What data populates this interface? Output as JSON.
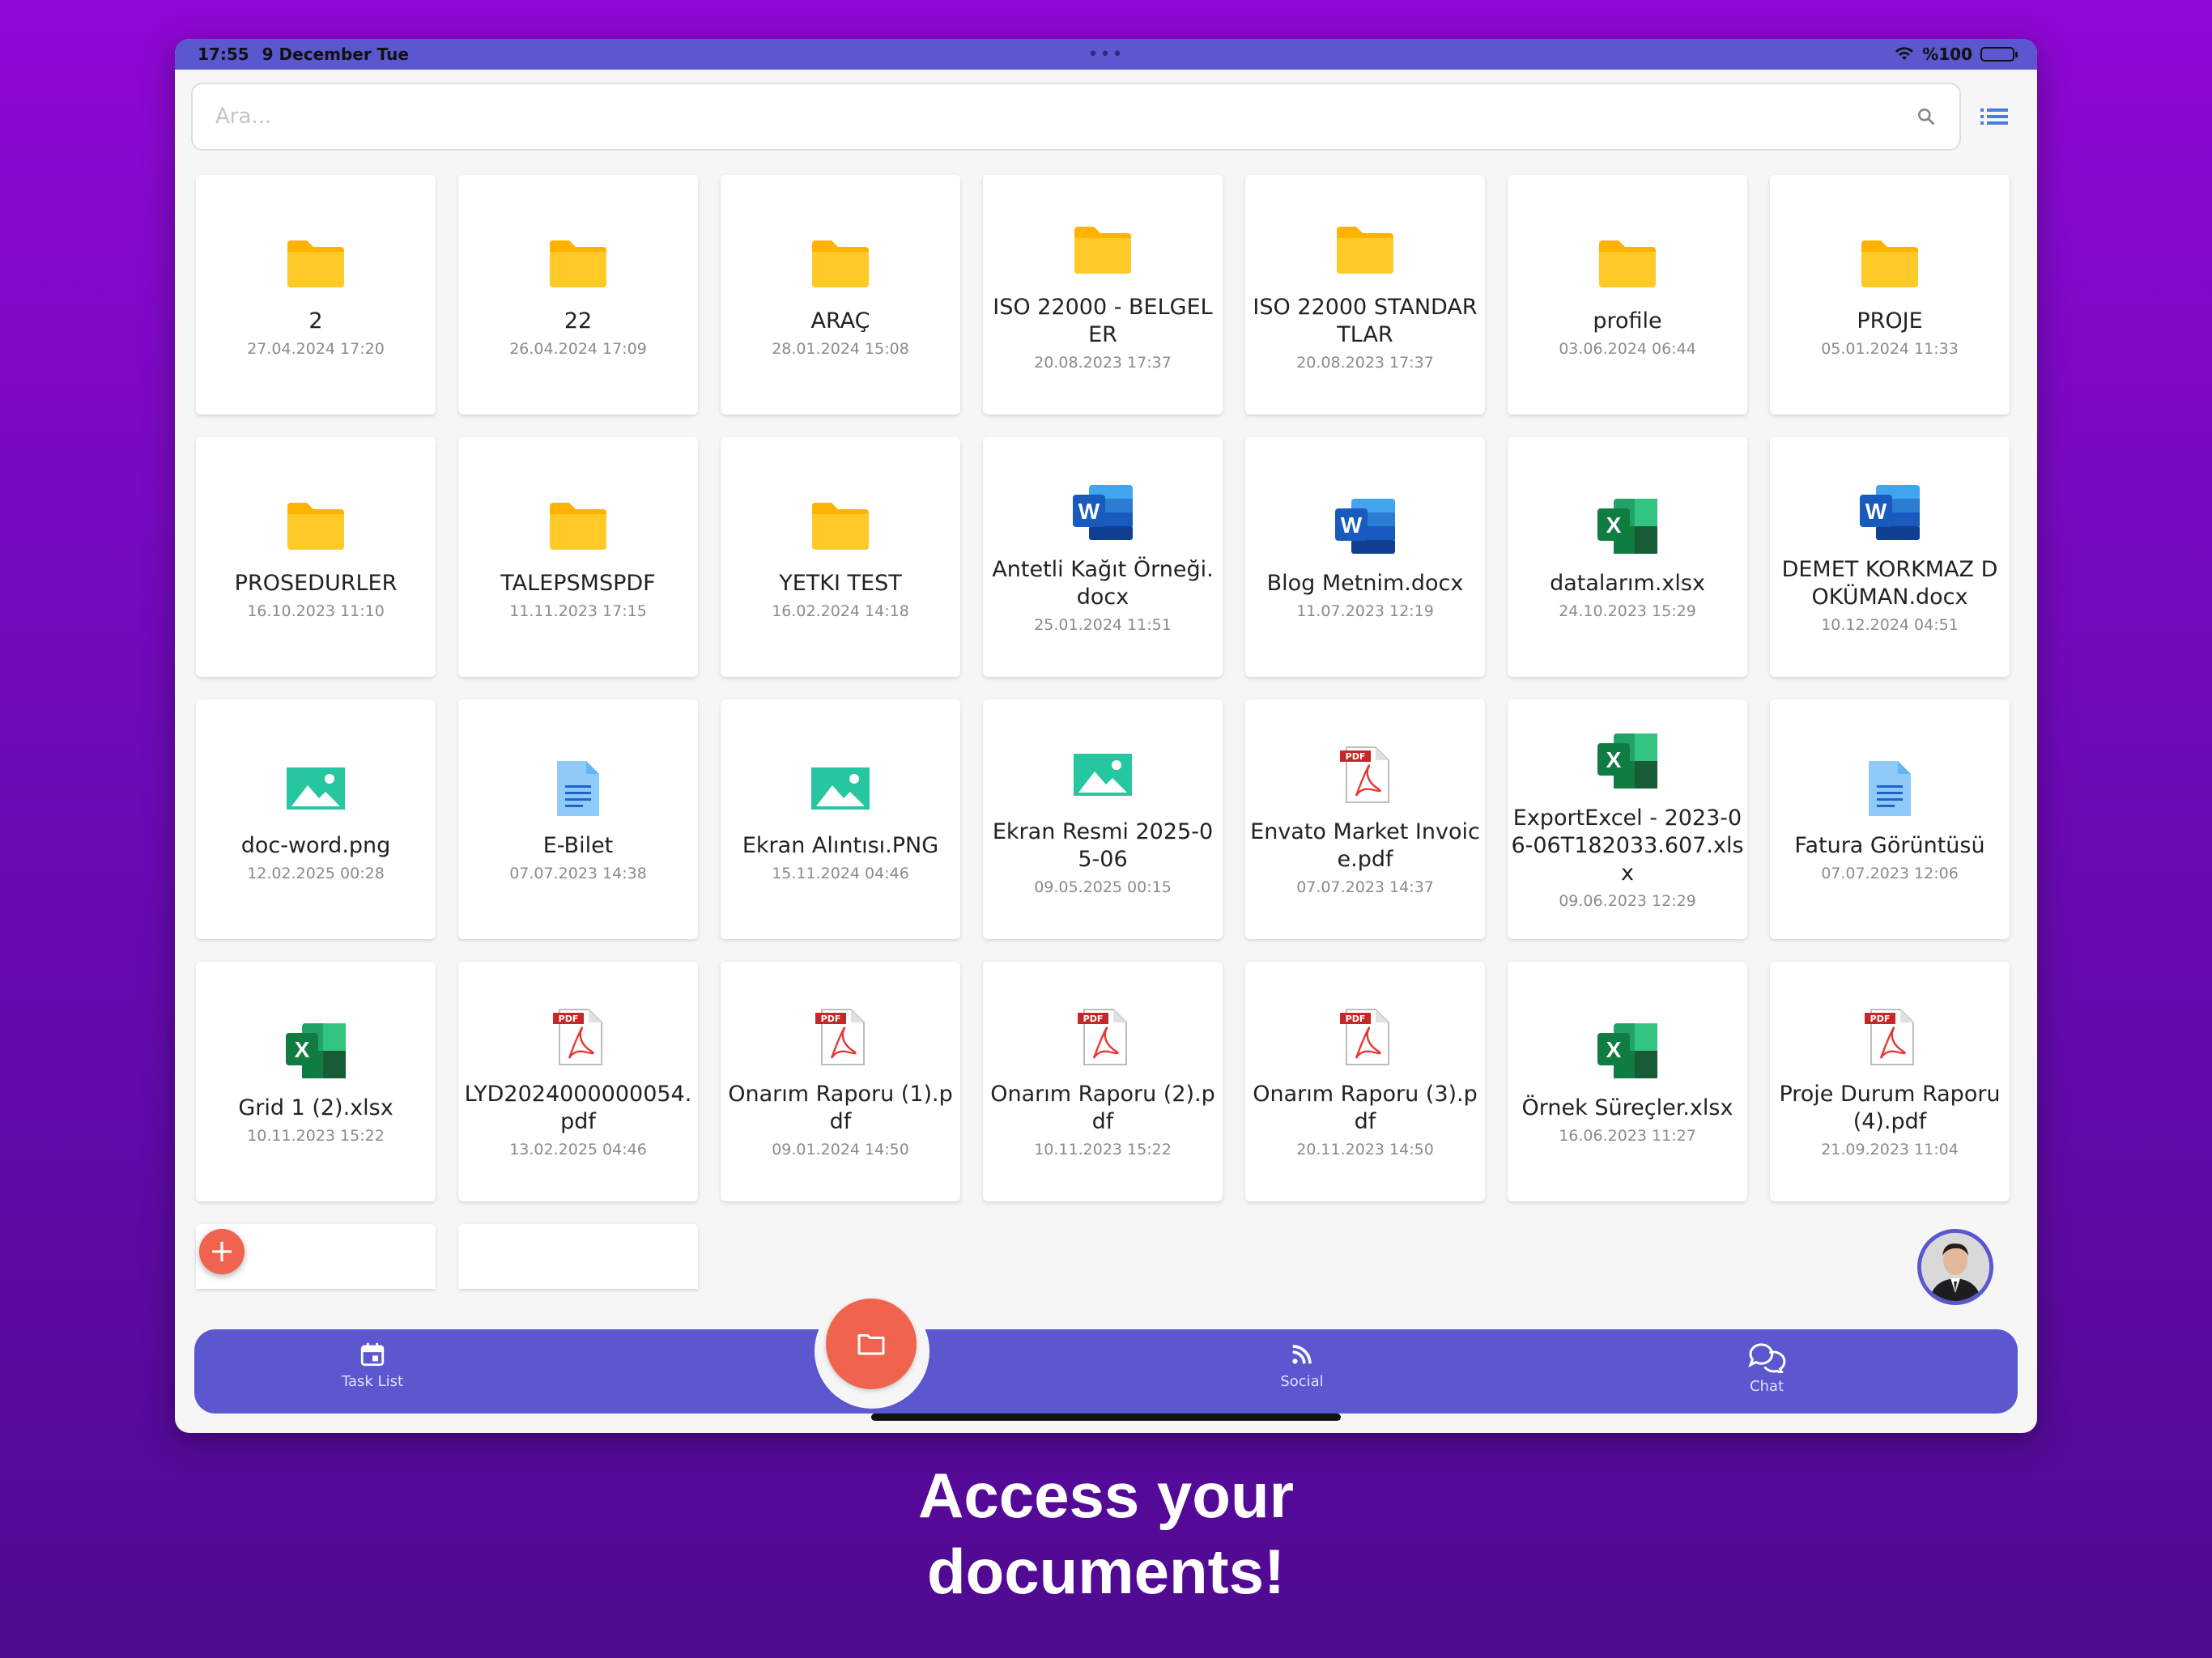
{
  "status_bar": {
    "time": "17:55",
    "date": "9 December Tue",
    "battery": "%100"
  },
  "search": {
    "placeholder": "Ara..."
  },
  "files": [
    {
      "name": "2",
      "date": "27.04.2024 17:20",
      "type": "folder"
    },
    {
      "name": "22",
      "date": "26.04.2024 17:09",
      "type": "folder"
    },
    {
      "name": "ARAÇ",
      "date": "28.01.2024 15:08",
      "type": "folder"
    },
    {
      "name": "ISO 22000 - BELGELER",
      "date": "20.08.2023 17:37",
      "type": "folder"
    },
    {
      "name": "ISO 22000 STANDARTLAR",
      "date": "20.08.2023 17:37",
      "type": "folder"
    },
    {
      "name": "profile",
      "date": "03.06.2024 06:44",
      "type": "folder"
    },
    {
      "name": "PROJE",
      "date": "05.01.2024 11:33",
      "type": "folder"
    },
    {
      "name": "PROSEDURLER",
      "date": "16.10.2023 11:10",
      "type": "folder"
    },
    {
      "name": "TALEPSMSPDF",
      "date": "11.11.2023 17:15",
      "type": "folder"
    },
    {
      "name": "YETKI TEST",
      "date": "16.02.2024 14:18",
      "type": "folder"
    },
    {
      "name": "Antetli Kağıt Örneği.docx",
      "date": "25.01.2024 11:51",
      "type": "word"
    },
    {
      "name": "Blog Metnim.docx",
      "date": "11.07.2023 12:19",
      "type": "word"
    },
    {
      "name": "datalarım.xlsx",
      "date": "24.10.2023 15:29",
      "type": "excel"
    },
    {
      "name": "DEMET KORKMAZ DOKÜMAN.docx",
      "date": "10.12.2024 04:51",
      "type": "word"
    },
    {
      "name": "doc-word.png",
      "date": "12.02.2025 00:28",
      "type": "image"
    },
    {
      "name": "E-Bilet",
      "date": "07.07.2023 14:38",
      "type": "doc"
    },
    {
      "name": "Ekran Alıntısı.PNG",
      "date": "15.11.2024 04:46",
      "type": "image"
    },
    {
      "name": "Ekran Resmi 2025-05-06",
      "date": "09.05.2025 00:15",
      "type": "image"
    },
    {
      "name": "Envato Market Invoice.pdf",
      "date": "07.07.2023 14:37",
      "type": "pdf"
    },
    {
      "name": "ExportExcel - 2023-06-06T182033.607.xlsx",
      "date": "09.06.2023 12:29",
      "type": "excel"
    },
    {
      "name": "Fatura Görüntüsü",
      "date": "07.07.2023 12:06",
      "type": "doc"
    },
    {
      "name": "Grid 1 (2).xlsx",
      "date": "10.11.2023 15:22",
      "type": "excel"
    },
    {
      "name": "LYD2024000000054.pdf",
      "date": "13.02.2025 04:46",
      "type": "pdf"
    },
    {
      "name": "Onarım Raporu (1).pdf",
      "date": "09.01.2024 14:50",
      "type": "pdf"
    },
    {
      "name": "Onarım Raporu (2).pdf",
      "date": "10.11.2023 15:22",
      "type": "pdf"
    },
    {
      "name": "Onarım Raporu (3).pdf",
      "date": "20.11.2023 14:50",
      "type": "pdf"
    },
    {
      "name": "Örnek Süreçler.xlsx",
      "date": "16.06.2023 11:27",
      "type": "excel"
    },
    {
      "name": "Proje Durum Raporu (4).pdf",
      "date": "21.09.2023 11:04",
      "type": "pdf"
    }
  ],
  "bottom_nav": {
    "task_list": "Task List",
    "social": "Social",
    "chat": "Chat"
  },
  "promo": {
    "line1": "Access your",
    "line2": "documents!"
  },
  "colors": {
    "accent": "#5a57cf",
    "fab": "#f0634f",
    "folder": "#ffca28"
  }
}
